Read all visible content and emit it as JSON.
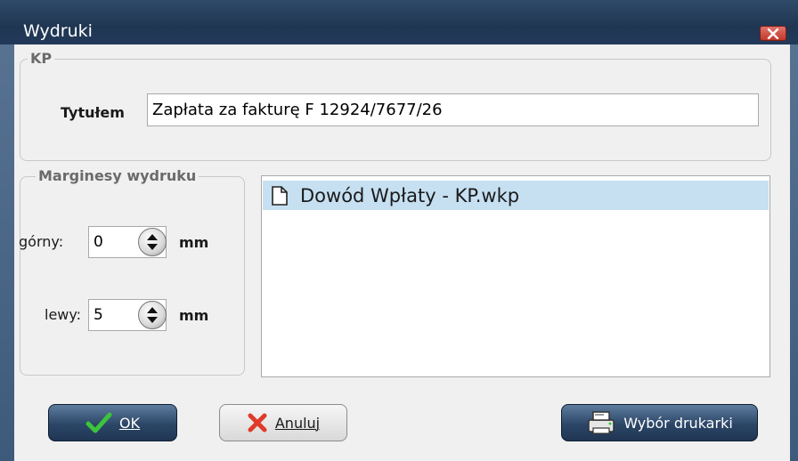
{
  "window": {
    "title": "Wydruki",
    "close_icon": "close-icon"
  },
  "kp_group": {
    "label": "KP",
    "title_label": "Tytułem",
    "title_value": "Zapłata za fakturę F 12924/7677/26"
  },
  "margins_group": {
    "label": "Marginesy wydruku",
    "top_label": "górny:",
    "top_value": "0",
    "top_unit": "mm",
    "left_label": "lewy:",
    "left_value": "5",
    "left_unit": "mm"
  },
  "templates_list": {
    "items": [
      {
        "label": "Dowód Wpłaty - KP.wkp",
        "icon": "document-icon",
        "selected": true
      }
    ]
  },
  "buttons": {
    "ok_label": "OK",
    "cancel_label": "Anuluj",
    "printer_label": "Wybór drukarki"
  },
  "colors": {
    "titlebar": "#1f3652",
    "selection": "#c6e0f2",
    "ok_check": "#3cc43c",
    "cancel_x": "#e03a2a"
  }
}
